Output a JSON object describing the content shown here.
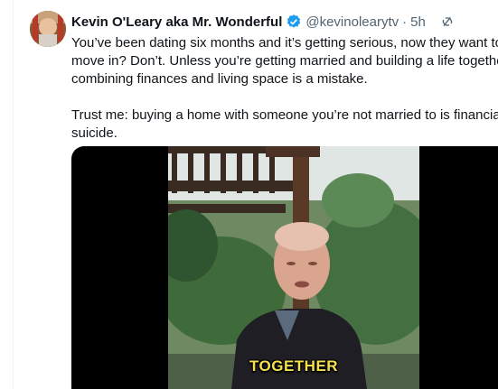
{
  "tweet": {
    "author_name": "Kevin O'Leary aka Mr. Wonderful",
    "handle": "@kevinolearytv",
    "separator": "·",
    "timestamp": "5h",
    "verified_icon": "verified-badge-icon",
    "lines": [
      "You’ve been dating six months and it’s getting serious, now they want to",
      "move in? Don’t. Unless you’re getting married and building a life together,",
      "combining finances and living space is a mistake.",
      "",
      "Trust me: buying a home with someone you’re not married to is financial",
      "suicide."
    ]
  },
  "media": {
    "caption": "TOGETHER"
  },
  "colors": {
    "text": "#0f1419",
    "secondary": "#536471",
    "verified_blue": "#1d9bf0",
    "caption_yellow": "#f4e04d"
  }
}
